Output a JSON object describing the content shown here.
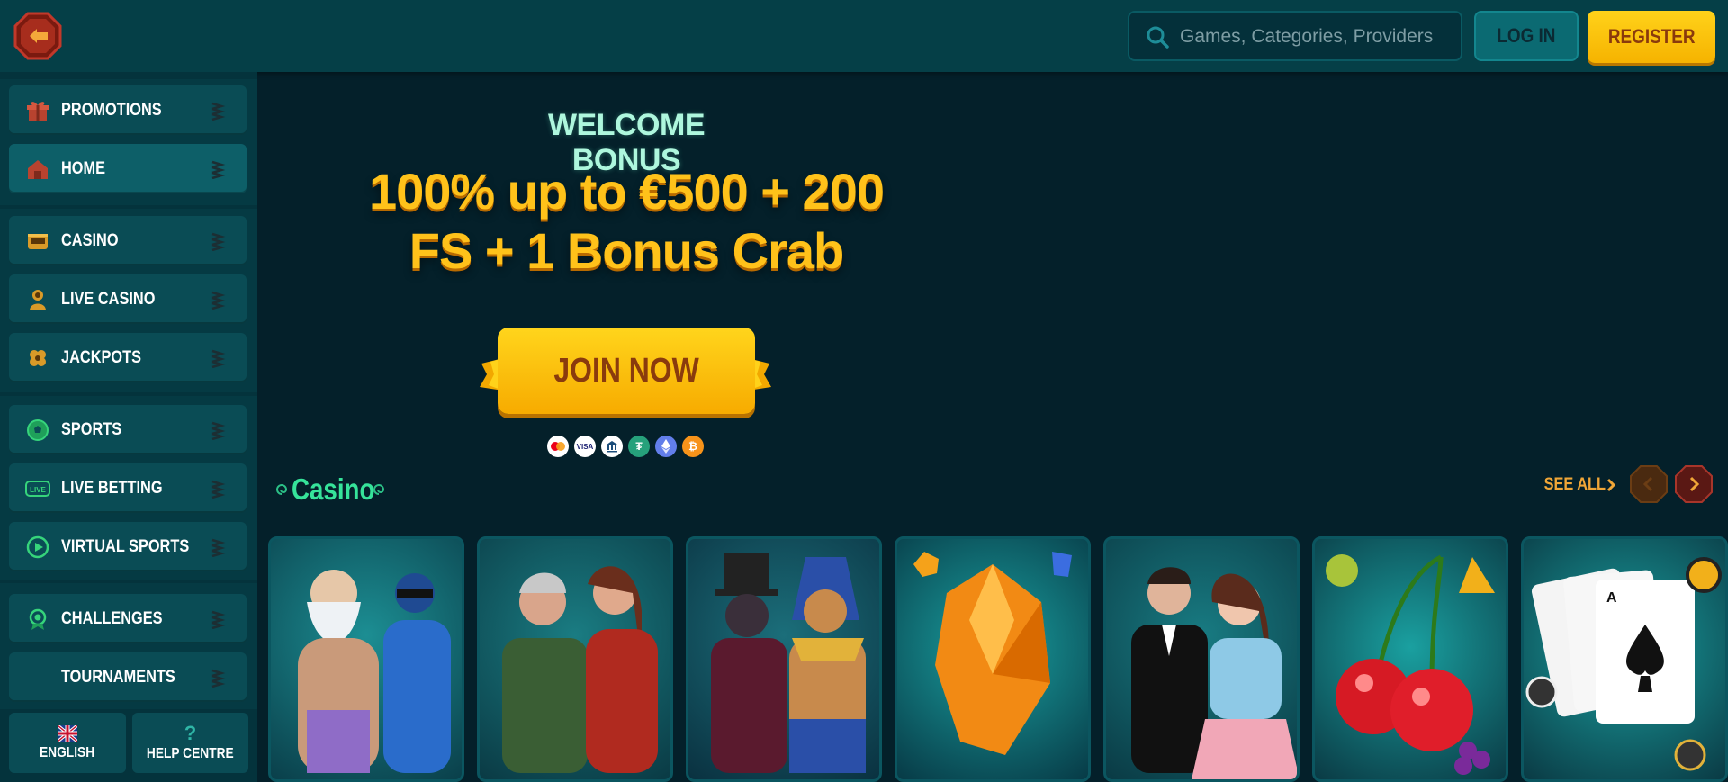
{
  "header": {
    "search_placeholder": "Games, Categories, Providers",
    "login_label": "LOG IN",
    "register_label": "REGISTER"
  },
  "sidebar": {
    "items": [
      {
        "label": "PROMOTIONS",
        "icon": "gift-icon"
      },
      {
        "label": "HOME",
        "icon": "home-icon"
      },
      {
        "label": "CASINO",
        "icon": "casino-icon"
      },
      {
        "label": "LIVE CASINO",
        "icon": "dealer-icon"
      },
      {
        "label": "JACKPOTS",
        "icon": "clover-icon"
      },
      {
        "label": "SPORTS",
        "icon": "soccer-ball-icon"
      },
      {
        "label": "LIVE BETTING",
        "icon": "live-icon"
      },
      {
        "label": "VIRTUAL SPORTS",
        "icon": "play-icon"
      },
      {
        "label": "CHALLENGES",
        "icon": "medal-icon"
      },
      {
        "label": "TOURNAMENTS",
        "icon": ""
      }
    ],
    "language_label": "ENGLISH",
    "help_label": "HELP CENTRE"
  },
  "hero": {
    "welcome": "WELCOME BONUS",
    "headline_line1": "100% up to €500 + 200",
    "headline_line2": "FS + 1 Bonus Crab",
    "cta": "JOIN NOW",
    "payment_methods": [
      "mastercard-icon",
      "visa-icon",
      "bank-icon",
      "tether-icon",
      "ethereum-icon",
      "bitcoin-icon"
    ]
  },
  "casino_section": {
    "title": "Casino",
    "see_all": "SEE ALL"
  },
  "colors": {
    "header_bg": "#053f47",
    "page_bg": "#04202a",
    "accent_yellow": "#ffc21a",
    "accent_green": "#36e39a",
    "see_all_orange": "#f0a637"
  }
}
